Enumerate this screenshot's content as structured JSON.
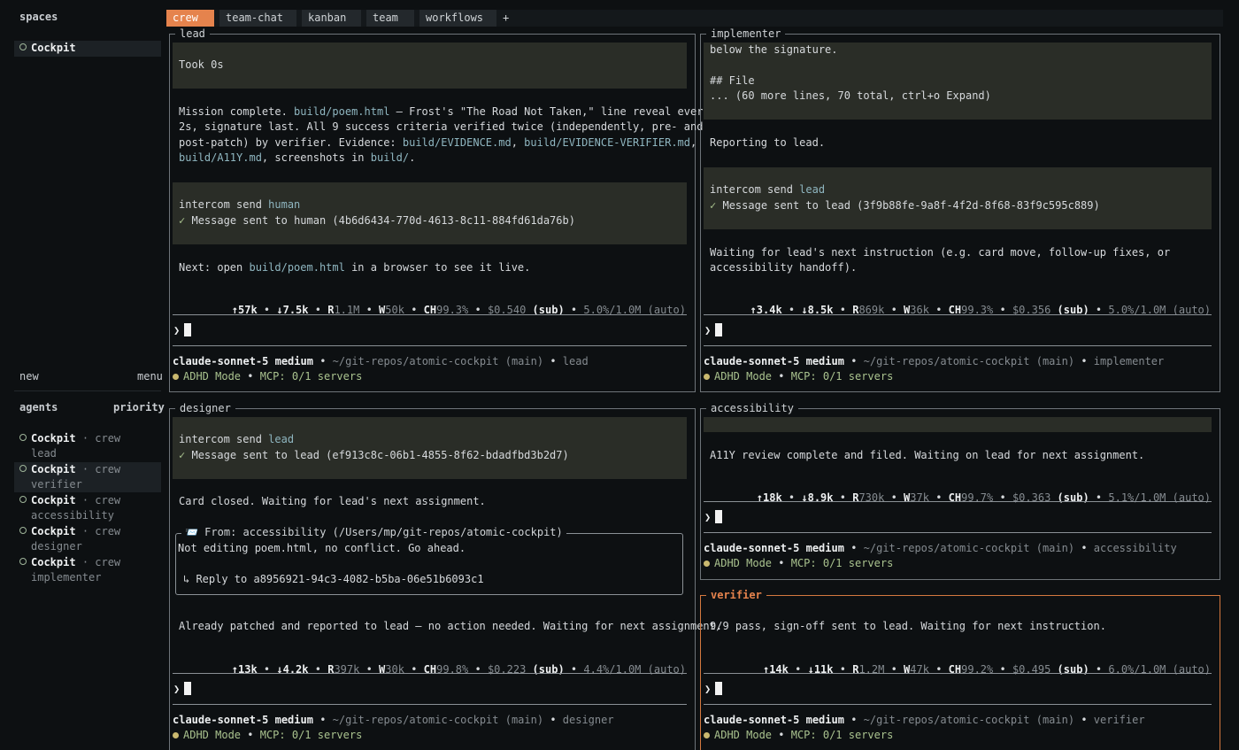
{
  "sidebar": {
    "spaces_header": "spaces",
    "spaces": [
      {
        "label": "Cockpit"
      }
    ],
    "new_label": "new",
    "menu_label": "menu",
    "agents_header": "agents",
    "priority_label": "priority",
    "agents": [
      {
        "name": "Cockpit",
        "space": "· crew",
        "role": "lead"
      },
      {
        "name": "Cockpit",
        "space": "· crew",
        "role": "verifier"
      },
      {
        "name": "Cockpit",
        "space": "· crew",
        "role": "accessibility"
      },
      {
        "name": "Cockpit",
        "space": "· crew",
        "role": "designer"
      },
      {
        "name": "Cockpit",
        "space": "· crew",
        "role": "implementer"
      }
    ]
  },
  "tabs": [
    {
      "label": "crew"
    },
    {
      "label": "team-chat"
    },
    {
      "label": "kanban"
    },
    {
      "label": "team"
    },
    {
      "label": "workflows"
    }
  ],
  "tab_add": "+",
  "common": {
    "bullet": "•",
    "check": "✓",
    "prompt": "❯",
    "intercom_cmd": "intercom send ",
    "model": "claude-sonnet-5 medium",
    "sub": "(sub)",
    "adhd": "ADHD Mode",
    "mcp": "MCP: 0/1 servers",
    "repo": "~/git-repos/atomic-cockpit (main)"
  },
  "panes": {
    "lead": {
      "title": "lead",
      "took": "Took 0s",
      "msg1_a": "Mission complete. ",
      "msg1_link1": "build/poem.html",
      "msg1_b": " — Frost's \"The Road Not Taken,\" line reveal every",
      "msg1_line2": "2s, signature last. All 9 success criteria verified twice (independently, pre- and",
      "msg1_line3a": "post-patch) by verifier. Evidence: ",
      "msg1_link2": "build/EVIDENCE.md",
      "msg1_comma1": ", ",
      "msg1_link3": "build/EVIDENCE-VERIFIER.md",
      "msg1_comma2": ",",
      "msg1_link4": "build/A11Y.md",
      "msg1_line4b": ", screenshots in ",
      "msg1_link5": "build/",
      "msg1_end": ".",
      "intercom_target": "human",
      "sent": "Message sent to human (4b6d6434-770d-4613-8c11-884fd61da76b)",
      "next_a": "Next: open ",
      "next_link": "build/poem.html",
      "next_b": " in a browser to see it live.",
      "stats": {
        "up": "↑57k",
        "down": "↓7.5k",
        "r_label": "R",
        "r": "1.1M",
        "w_label": "W",
        "w": "50k",
        "ch_label": "CH",
        "ch": "99.3%",
        "cost": "$0.540",
        "ctx": "5.0%/1.0M",
        "auto": "(auto)"
      },
      "role": "lead"
    },
    "implementer": {
      "title": "implementer",
      "code1": "below the signature.",
      "code2": "## File",
      "code3": "... (60 more lines, 70 total, ctrl+o Expand)",
      "reporting": "Reporting to lead.",
      "intercom_target": "lead",
      "sent": "Message sent to lead (3f9b88fe-9a8f-4f2d-8f68-83f9c595c889)",
      "wait1": "Waiting for lead's next instruction (e.g. card move, follow-up fixes, or",
      "wait2": "accessibility handoff).",
      "stats": {
        "up": "↑3.4k",
        "down": "↓8.5k",
        "r_label": "R",
        "r": "869k",
        "w_label": "W",
        "w": "36k",
        "ch_label": "CH",
        "ch": "99.3%",
        "cost": "$0.356",
        "ctx": "5.0%/1.0M",
        "auto": "(auto)"
      },
      "role": "implementer"
    },
    "designer": {
      "title": "designer",
      "intercom_target": "lead",
      "sent": "Message sent to lead (ef913c8c-06b1-4855-8f62-bdadfbd3b2d7)",
      "card_closed": "Card closed. Waiting for lead's next assignment.",
      "mail_from": "📨 From: accessibility (/Users/mp/git-repos/atomic-cockpit)",
      "mail_body": "Not editing poem.html, no conflict. Go ahead.",
      "mail_reply": "↳ Reply to a8956921-94c3-4082-b5ba-06e51b6093c1",
      "patched": "Already patched and reported to lead — no action needed. Waiting for next assignment.",
      "stats": {
        "up": "↑13k",
        "down": "↓4.2k",
        "r_label": "R",
        "r": "397k",
        "w_label": "W",
        "w": "30k",
        "ch_label": "CH",
        "ch": "99.8%",
        "cost": "$0.223",
        "ctx": "4.4%/1.0M",
        "auto": "(auto)"
      },
      "role": "designer"
    },
    "accessibility": {
      "title": "accessibility",
      "review": "A11Y review complete and filed. Waiting on lead for next assignment.",
      "stats": {
        "up": "↑18k",
        "down": "↓8.9k",
        "r_label": "R",
        "r": "730k",
        "w_label": "W",
        "w": "37k",
        "ch_label": "CH",
        "ch": "99.7%",
        "cost": "$0.363",
        "ctx": "5.1%/1.0M",
        "auto": "(auto)"
      },
      "role": "accessibility"
    },
    "verifier": {
      "title": "verifier",
      "pass": "9/9 pass, sign-off sent to lead. Waiting for next instruction.",
      "stats": {
        "up": "↑14k",
        "down": "↓11k",
        "r_label": "R",
        "r": "1.2M",
        "w_label": "W",
        "w": "47k",
        "ch_label": "CH",
        "ch": "99.2%",
        "cost": "$0.495",
        "ctx": "6.0%/1.0M",
        "auto": "(auto)"
      },
      "role": "verifier"
    }
  },
  "colors": {
    "accent": "#e5834d",
    "link": "#8fb6c0",
    "ok": "#aac38f",
    "block_bg": "#2a2d27",
    "bg": "#0d1012"
  }
}
